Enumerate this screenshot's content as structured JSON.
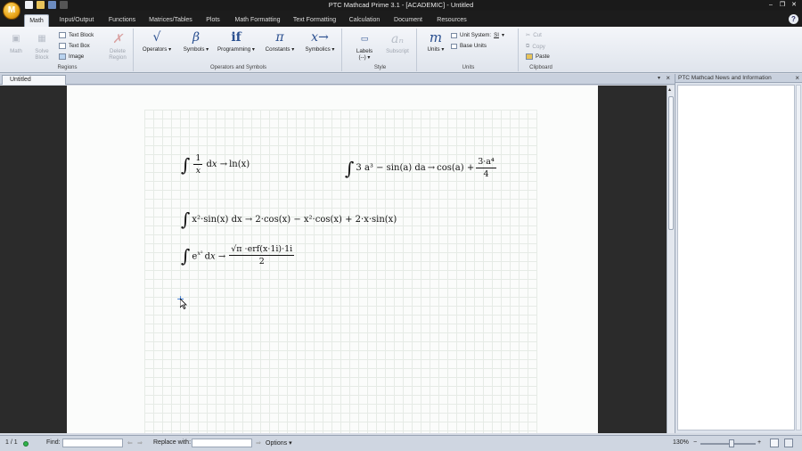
{
  "window": {
    "title": "PTC Mathcad Prime 3.1 - [ACADEMIC] - Untitled"
  },
  "app_orb_letter": "M",
  "ribbon_tabs": [
    "Math",
    "Input/Output",
    "Functions",
    "Matrices/Tables",
    "Plots",
    "Math Formatting",
    "Text Formatting",
    "Calculation",
    "Document",
    "Resources"
  ],
  "help_label": "?",
  "groups": {
    "regions": {
      "label": "Regions",
      "math": "Math",
      "solve_block": "Solve Block",
      "text_block": "Text Block",
      "text_box": "Text Box",
      "image": "Image",
      "delete_region": "Delete Region"
    },
    "operators_symbols": {
      "label": "Operators and Symbols",
      "operators": "Operators",
      "symbols": "Symbols",
      "programming": "Programming",
      "constants": "Constants",
      "symbolics": "Symbolics"
    },
    "style": {
      "label": "Style",
      "labels": "Labels",
      "labels_value": "(--)",
      "subscript": "Subscript"
    },
    "units": {
      "label": "Units",
      "units": "Units",
      "unit_system": "Unit System:",
      "unit_system_value": "SI",
      "base_units": "Base Units"
    },
    "clipboard": {
      "label": "Clipboard",
      "cut": "Cut",
      "copy": "Copy",
      "paste": "Paste"
    }
  },
  "document_tab": "Untitled",
  "right_panel": {
    "title": "PTC Mathcad News and Information"
  },
  "equations": {
    "eq1_result": "ln(x)",
    "eq2_lhs": "3 a³ − sin(a) da",
    "eq2_result": "cos(a) +",
    "eq2_frac_num": "3·a⁴",
    "eq2_frac_den": "4",
    "eq3": "x²·sin(x) dx → 2·cos(x) − x²·cos(x) + 2·x·sin(x)",
    "eq4_num": "√π ·erf(x·1i)·1i",
    "eq4_den": "2"
  },
  "status": {
    "page": "1 / 1",
    "find_label": "Find:",
    "replace_label": "Replace with:",
    "options_label": "Options",
    "zoom": "130%"
  }
}
